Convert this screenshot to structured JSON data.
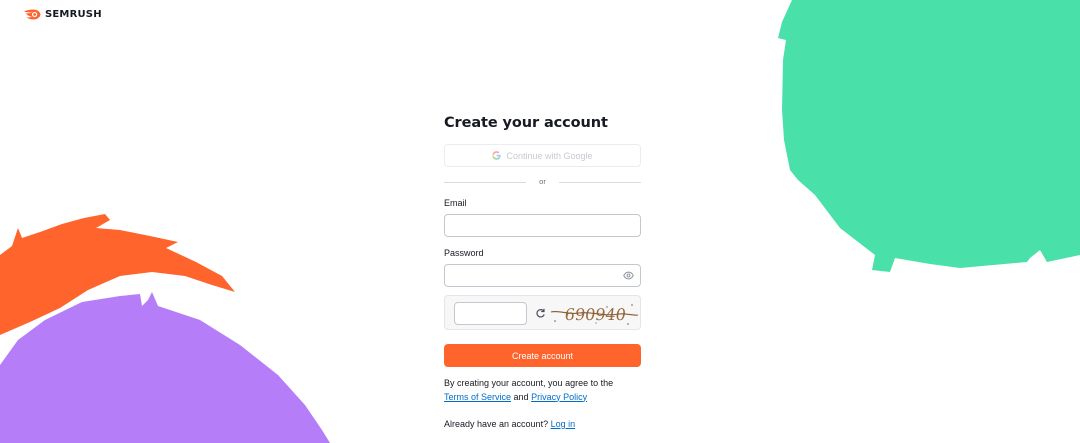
{
  "brand": {
    "name": "SEMRUSH",
    "logo_icon": "semrush-flame-icon",
    "accent": "#ff642d"
  },
  "form": {
    "title": "Create your account",
    "google_button": {
      "label": "Continue with Google",
      "icon": "google-icon"
    },
    "divider_text": "or",
    "email": {
      "label": "Email",
      "value": "",
      "placeholder": ""
    },
    "password": {
      "label": "Password",
      "value": "",
      "placeholder": "",
      "toggle_icon": "eye-icon"
    },
    "captcha": {
      "value": "",
      "image_text": "690940",
      "refresh_icon": "refresh-icon"
    },
    "submit_label": "Create account",
    "terms": {
      "prefix": "By creating your account, you agree to the",
      "tos_link": "Terms of Service",
      "and": "and",
      "privacy_link": "Privacy Policy"
    },
    "login": {
      "prompt": "Already have an account?",
      "link": "Log in"
    }
  },
  "colors": {
    "orange": "#ff642d",
    "green": "#4ae0a9",
    "purple": "#b57ef8",
    "link": "#006dca"
  }
}
